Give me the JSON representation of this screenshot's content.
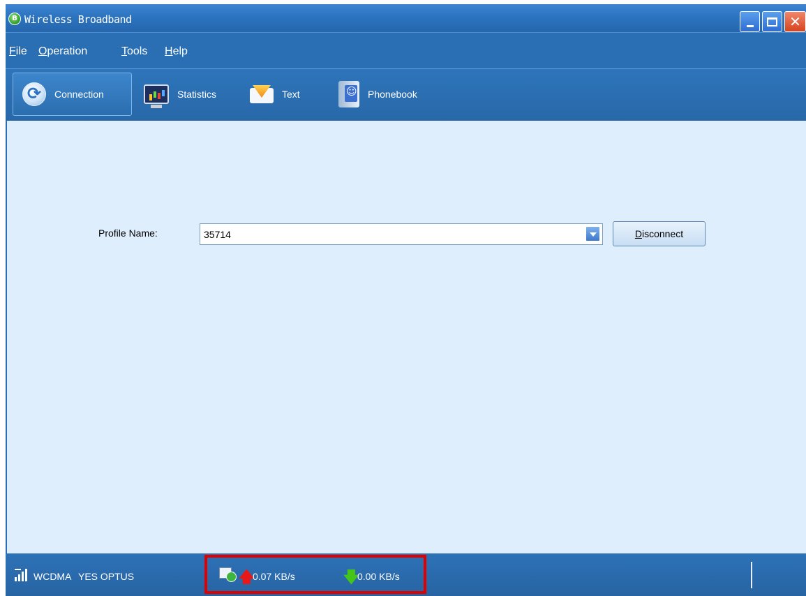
{
  "window": {
    "title": "Wireless Broadband",
    "controls": {
      "minimize": "minimize",
      "maximize": "maximize",
      "close": "close"
    }
  },
  "menu": [
    {
      "label_prefix": "",
      "accel": "F",
      "label_suffix": "ile"
    },
    {
      "label_prefix": "",
      "accel": "O",
      "label_suffix": "peration"
    },
    {
      "label_prefix": "",
      "accel": "T",
      "label_suffix": "ools"
    },
    {
      "label_prefix": "",
      "accel": "H",
      "label_suffix": "elp"
    }
  ],
  "toolbar": {
    "connection": "Connection",
    "statistics": "Statistics",
    "text": "Text",
    "phonebook": "Phonebook",
    "active": "Connection"
  },
  "connection": {
    "profile_label": "Profile Name:",
    "profile_value": "35714",
    "disconnect_accel": "D",
    "disconnect_rest": "isconnect"
  },
  "status": {
    "network_mode": "WCDMA",
    "carrier": "YES OPTUS",
    "upload_speed": "0.07 KB/s",
    "download_speed": "0.00 KB/s",
    "highlight_color": "#e10000"
  }
}
